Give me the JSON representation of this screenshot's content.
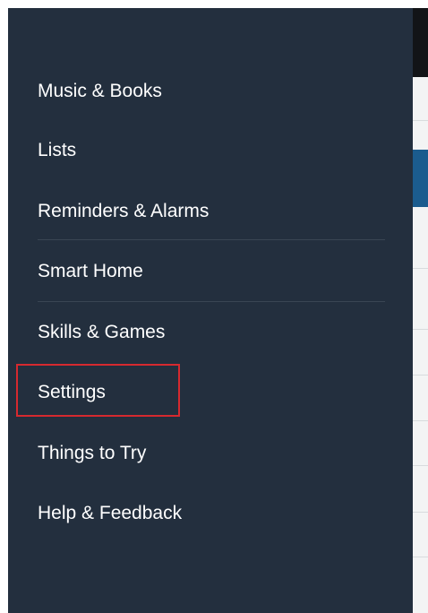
{
  "menu": {
    "items": [
      {
        "id": "music-books",
        "label": "Music & Books"
      },
      {
        "id": "lists",
        "label": "Lists"
      },
      {
        "id": "reminders-alarms",
        "label": "Reminders & Alarms"
      },
      {
        "id": "smart-home",
        "label": "Smart Home"
      },
      {
        "id": "skills-games",
        "label": "Skills & Games"
      },
      {
        "id": "settings",
        "label": "Settings",
        "highlighted": true
      },
      {
        "id": "things-to-try",
        "label": "Things to Try"
      },
      {
        "id": "help-feedback",
        "label": "Help & Feedback"
      }
    ]
  },
  "colors": {
    "drawer_bg": "#232f3e",
    "text": "#ffffff",
    "divider": "#3a4653",
    "highlight_border": "#d6292f",
    "background_app": "#f3f4f4",
    "background_topbar": "#121417",
    "background_accent": "#1b5c8e"
  }
}
